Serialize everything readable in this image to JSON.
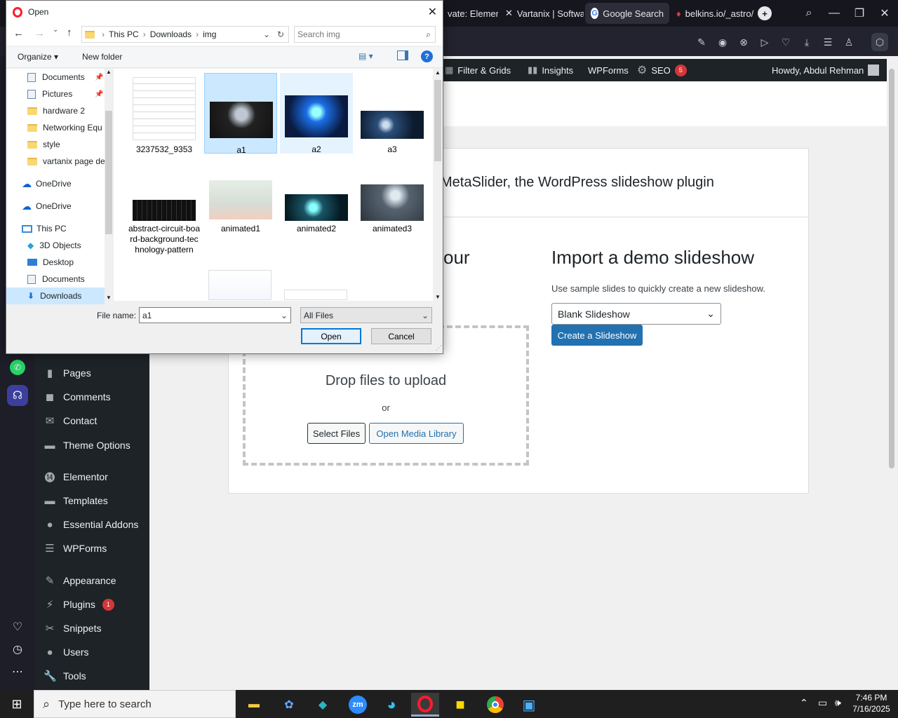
{
  "browser": {
    "tabs": [
      {
        "label": "vate: Elemente",
        "icon": "elementor-icon"
      },
      {
        "label": "Vartanix | Softwa",
        "icon": "vartanix-icon"
      },
      {
        "label": "Google Search",
        "icon": "google-icon"
      },
      {
        "label": "belkins.io/_astro/",
        "icon": "belkins-icon"
      }
    ],
    "new_tab": "+"
  },
  "wp": {
    "adminbar": {
      "filter_grids": "Filter & Grids",
      "insights": "Insights",
      "wpforms": "WPForms",
      "seo": "SEO",
      "seo_count": "5",
      "howdy": "Howdy, Abdul Rehman"
    },
    "menu": [
      {
        "label": "Pages",
        "icon": "pages-icon",
        "glyph": "▮"
      },
      {
        "label": "Comments",
        "icon": "comments-icon",
        "glyph": "◼"
      },
      {
        "label": "Contact",
        "icon": "contact-icon",
        "glyph": "✉"
      },
      {
        "label": "Theme Options",
        "icon": "theme-options-icon",
        "glyph": "▬"
      },
      {
        "label": "Elementor",
        "icon": "elementor-icon",
        "glyph": "⓮"
      },
      {
        "label": "Templates",
        "icon": "templates-icon",
        "glyph": "▬"
      },
      {
        "label": "Essential Addons",
        "icon": "essential-addons-icon",
        "glyph": "●"
      },
      {
        "label": "WPForms",
        "icon": "wpforms-icon",
        "glyph": "☰"
      },
      {
        "label": "Appearance",
        "icon": "appearance-icon",
        "glyph": "✎"
      },
      {
        "label": "Plugins",
        "icon": "plugins-icon",
        "glyph": "⚡"
      },
      {
        "label": "Snippets",
        "icon": "snippets-icon",
        "glyph": "✂"
      },
      {
        "label": "Users",
        "icon": "users-icon",
        "glyph": "●"
      },
      {
        "label": "Tools",
        "icon": "tools-icon",
        "glyph": "🔧"
      }
    ],
    "plugins_count": "1",
    "header_partial": "MetaSlider, the WordPress slideshow plugin",
    "left_heading_partial": "our",
    "import_title": "Import a demo slideshow",
    "import_desc": "Use sample slides to quickly create a new slideshow.",
    "select_value": "Blank Slideshow",
    "create_button": "Create a Slideshow",
    "drop_text": "Drop files to upload",
    "or_text": "or",
    "select_files": "Select Files",
    "open_media": "Open Media Library"
  },
  "dialog": {
    "title": "Open",
    "breadcrumb": [
      "This PC",
      "Downloads",
      "img"
    ],
    "search_placeholder": "Search img",
    "organize": "Organize",
    "new_folder": "New folder",
    "tree": [
      {
        "label": "Documents",
        "icon": "documents-icon",
        "pinned": true
      },
      {
        "label": "Pictures",
        "icon": "pictures-icon",
        "pinned": true
      },
      {
        "label": "hardware 2",
        "icon": "folder-icon"
      },
      {
        "label": "Networking Equ",
        "icon": "folder-icon"
      },
      {
        "label": "style",
        "icon": "folder-icon"
      },
      {
        "label": "vartanix page de",
        "icon": "folder-icon"
      },
      {
        "label": "OneDrive",
        "icon": "onedrive-icon"
      },
      {
        "label": "OneDrive",
        "icon": "onedrive-icon"
      },
      {
        "label": "This PC",
        "icon": "this-pc-icon"
      },
      {
        "label": "3D Objects",
        "icon": "3d-objects-icon"
      },
      {
        "label": "Desktop",
        "icon": "desktop-icon"
      },
      {
        "label": "Documents",
        "icon": "documents-icon"
      },
      {
        "label": "Downloads",
        "icon": "downloads-icon"
      }
    ],
    "files": [
      {
        "name": "3237532_9353"
      },
      {
        "name": "a1"
      },
      {
        "name": "a2"
      },
      {
        "name": "a3"
      },
      {
        "name": "abstract-circuit-board-background-technology-pattern"
      },
      {
        "name": "animated1"
      },
      {
        "name": "animated2"
      },
      {
        "name": "animated3"
      }
    ],
    "filename_label": "File name:",
    "filename_value": "a1",
    "filetype": "All Files",
    "open_button": "Open",
    "cancel_button": "Cancel"
  },
  "taskbar": {
    "search_placeholder": "Type here to search",
    "time": "7:46 PM",
    "date": "7/16/2025"
  },
  "colors": {
    "wp_blue": "#2271b1",
    "wp_dark": "#1d2327",
    "selection": "#cce8ff"
  }
}
